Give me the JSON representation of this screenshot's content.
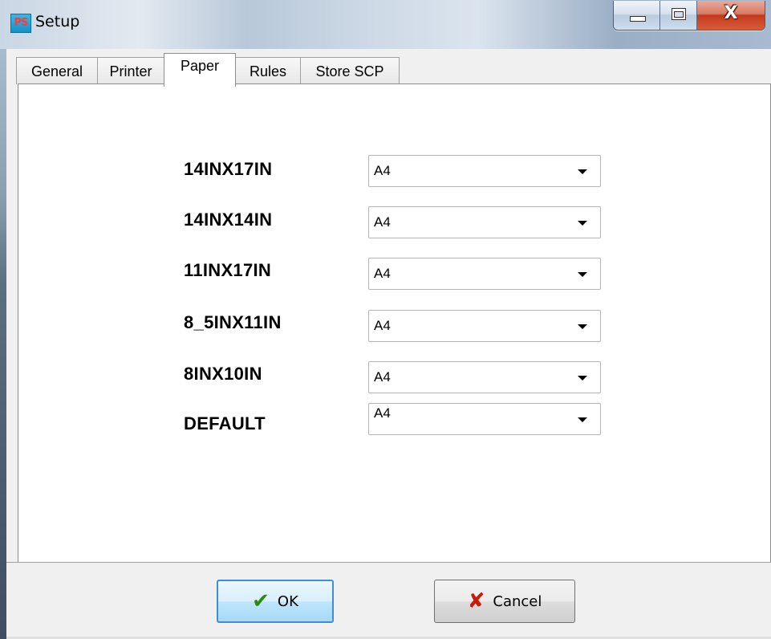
{
  "window": {
    "title": "Setup",
    "icon_text_p": "P",
    "icon_text_s": "S",
    "minimize_icon": "minimize-icon",
    "maximize_icon": "maximize-icon",
    "close_glyph": "X"
  },
  "tabs": [
    {
      "label": "General"
    },
    {
      "label": "Printer"
    },
    {
      "label": "Paper"
    },
    {
      "label": "Rules"
    },
    {
      "label": "Store SCP"
    }
  ],
  "active_tab": "Paper",
  "paper_rows": [
    {
      "label": "14INX17IN",
      "value": "A4"
    },
    {
      "label": "14INX14IN",
      "value": "A4"
    },
    {
      "label": "11INX17IN",
      "value": "A4"
    },
    {
      "label": "8_5INX11IN",
      "value": "A4"
    },
    {
      "label": "8INX10IN",
      "value": "A4"
    },
    {
      "label": "DEFAULT",
      "value": "A4"
    }
  ],
  "buttons": {
    "ok_label": "OK",
    "cancel_label": "Cancel",
    "ok_glyph": "✔",
    "cancel_glyph": "✘"
  },
  "colors": {
    "ok_icon": "#2f8a12",
    "cancel_icon": "#c71b0c",
    "close_button": "#c4391c",
    "focus_border": "#3c8fd2"
  }
}
